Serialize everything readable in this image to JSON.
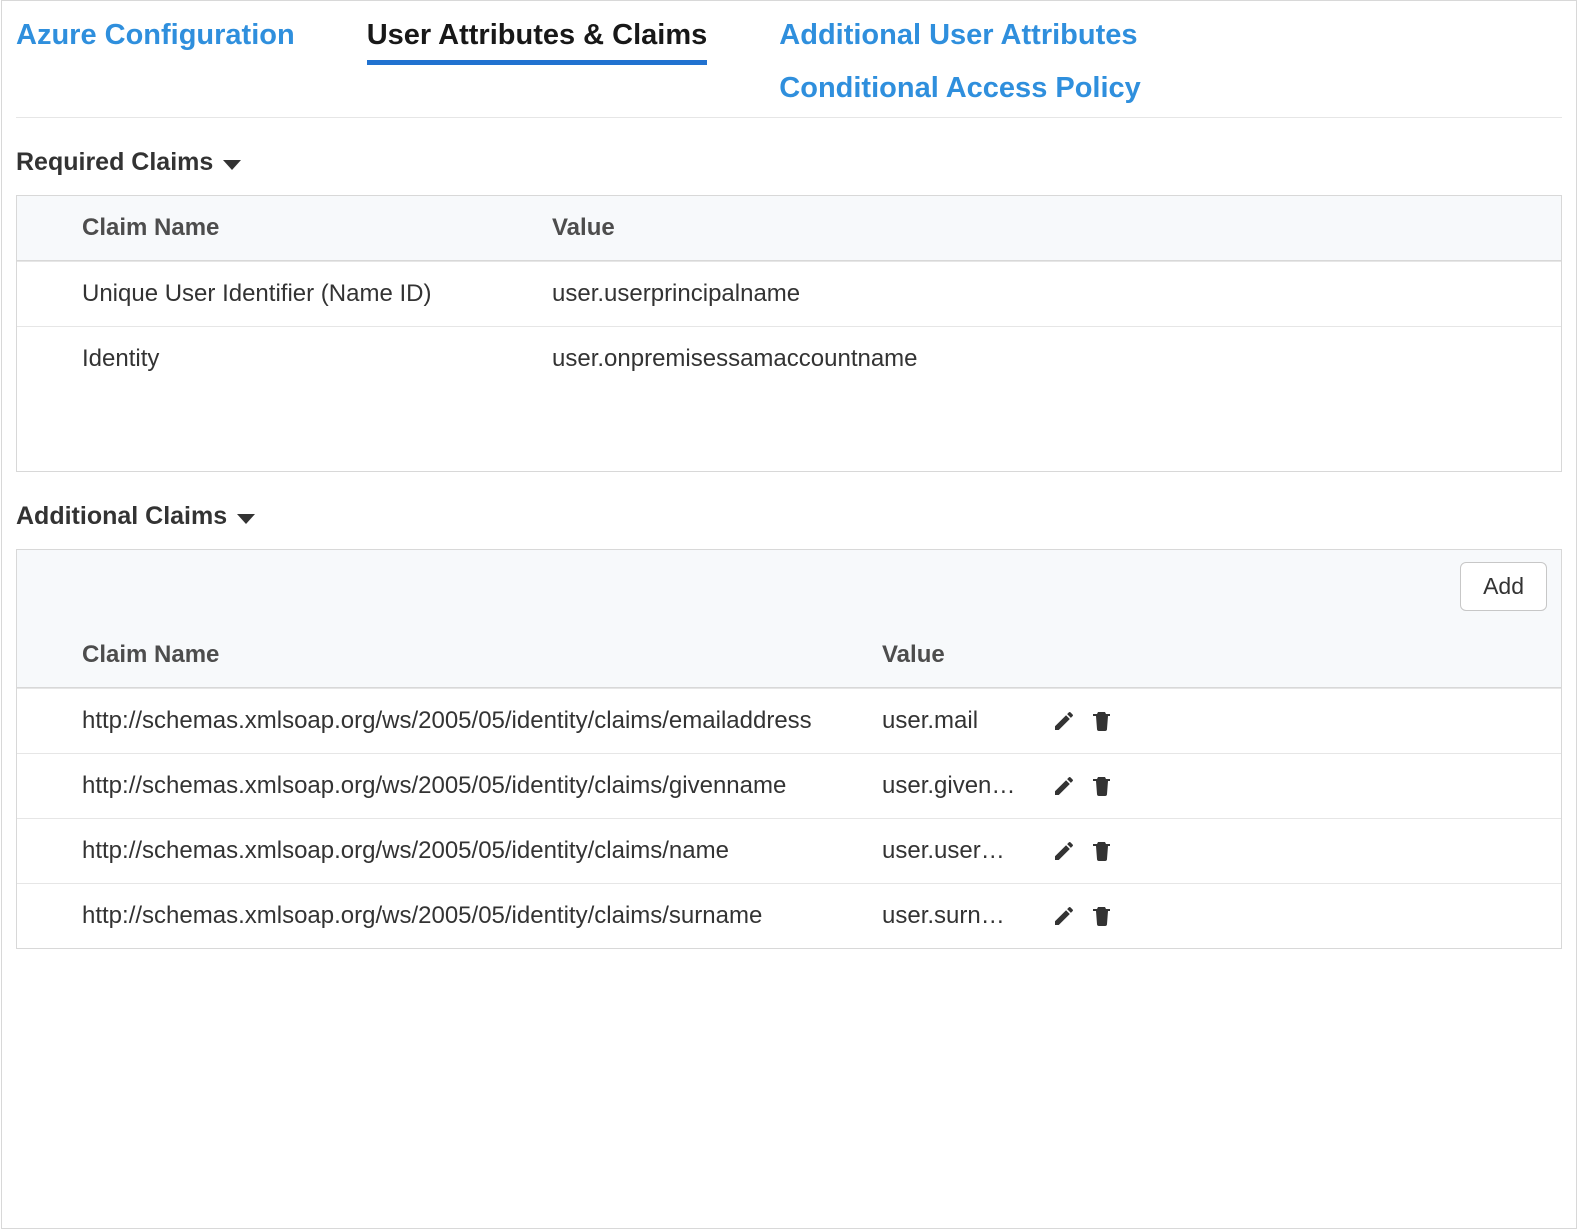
{
  "tabs": {
    "azure": "Azure Configuration",
    "claims": "User Attributes & Claims",
    "additional_attrs": "Additional User Attributes",
    "cap": "Conditional Access Policy"
  },
  "sections": {
    "required": "Required Claims",
    "additional": "Additional Claims"
  },
  "columns": {
    "claim_name": "Claim Name",
    "value": "Value"
  },
  "buttons": {
    "add": "Add"
  },
  "required_claims": [
    {
      "name": "Unique User Identifier (Name ID)",
      "value": "user.userprincipalname"
    },
    {
      "name": "Identity",
      "value": "user.onpremisessamaccountname"
    }
  ],
  "additional_claims": [
    {
      "name": "http://schemas.xmlsoap.org/ws/2005/05/identity/claims/emailaddress",
      "value": "user.mail"
    },
    {
      "name": "http://schemas.xmlsoap.org/ws/2005/05/identity/claims/givenname",
      "value": "user.given…"
    },
    {
      "name": "http://schemas.xmlsoap.org/ws/2005/05/identity/claims/name",
      "value": "user.user…"
    },
    {
      "name": "http://schemas.xmlsoap.org/ws/2005/05/identity/claims/surname",
      "value": "user.surn…"
    }
  ]
}
